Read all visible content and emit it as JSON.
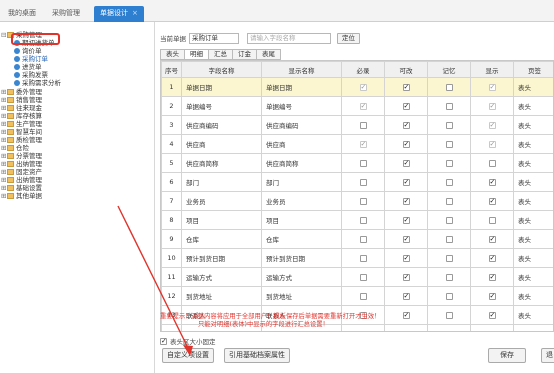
{
  "tabs": [
    {
      "label": "我的桌面"
    },
    {
      "label": "采购管理"
    },
    {
      "label": "单据设计",
      "close": "×"
    }
  ],
  "tree": [
    {
      "label": "采购管理",
      "kind": "folder",
      "toggle": "⊟"
    },
    {
      "label": "期初进货单",
      "kind": "leaf"
    },
    {
      "label": "询价单",
      "kind": "leaf"
    },
    {
      "label": "采购订单",
      "kind": "leaf",
      "selected": true
    },
    {
      "label": "进货单",
      "kind": "leaf"
    },
    {
      "label": "采购发票",
      "kind": "leaf"
    },
    {
      "label": "采购需求分析",
      "kind": "leaf"
    },
    {
      "label": "委外管理",
      "kind": "folder",
      "toggle": "⊞"
    },
    {
      "label": "销售管理",
      "kind": "folder",
      "toggle": "⊞"
    },
    {
      "label": "往来现金",
      "kind": "folder",
      "toggle": "⊞"
    },
    {
      "label": "库存核算",
      "kind": "folder",
      "toggle": "⊞"
    },
    {
      "label": "生产管理",
      "kind": "folder",
      "toggle": "⊞"
    },
    {
      "label": "智慧车间",
      "kind": "folder",
      "toggle": "⊞"
    },
    {
      "label": "质检管理",
      "kind": "folder",
      "toggle": "⊞"
    },
    {
      "label": "仓险",
      "kind": "folder",
      "toggle": "⊞"
    },
    {
      "label": "分票管理",
      "kind": "folder",
      "toggle": "⊞"
    },
    {
      "label": "出纳管理",
      "kind": "folder",
      "toggle": "⊞"
    },
    {
      "label": "固定资产",
      "kind": "folder",
      "toggle": "⊞"
    },
    {
      "label": "出纳管理",
      "kind": "folder",
      "toggle": "⊞"
    },
    {
      "label": "基础设置",
      "kind": "folder",
      "toggle": "⊞"
    },
    {
      "label": "其他单据",
      "kind": "folder",
      "toggle": "⊞"
    }
  ],
  "header": {
    "doc_label": "当前单据",
    "doc_value": "采购订单",
    "search_placeholder": "请输入字段名称",
    "locate_label": "定位"
  },
  "subtabs": [
    "表头",
    "明细",
    "汇总",
    "订金",
    "表尾"
  ],
  "table": {
    "columns": [
      "序号",
      "字段名称",
      "显示名称",
      "必录",
      "可改",
      "记忆",
      "显示",
      "页签"
    ],
    "rows": [
      {
        "no": "1",
        "field": "单据日期",
        "display": "单据日期",
        "req": [
          1,
          1
        ],
        "edit": [
          1,
          0
        ],
        "mem": [
          0,
          0
        ],
        "show": [
          1,
          1
        ],
        "tab": "表头",
        "sel": true
      },
      {
        "no": "2",
        "field": "单据编号",
        "display": "单据编号",
        "req": [
          1,
          1
        ],
        "edit": [
          1,
          0
        ],
        "mem": [
          0,
          0
        ],
        "show": [
          1,
          1
        ],
        "tab": "表头"
      },
      {
        "no": "3",
        "field": "供应商编码",
        "display": "供应商编码",
        "req": [
          0,
          0
        ],
        "edit": [
          1,
          0
        ],
        "mem": [
          0,
          0
        ],
        "show": [
          1,
          1
        ],
        "tab": "表头"
      },
      {
        "no": "4",
        "field": "供应商",
        "display": "供应商",
        "req": [
          1,
          1
        ],
        "edit": [
          1,
          0
        ],
        "mem": [
          0,
          0
        ],
        "show": [
          1,
          1
        ],
        "tab": "表头"
      },
      {
        "no": "5",
        "field": "供应商简称",
        "display": "供应商简称",
        "req": [
          0,
          0
        ],
        "edit": [
          1,
          0
        ],
        "mem": [
          0,
          0
        ],
        "show": [
          0,
          0
        ],
        "tab": "表头"
      },
      {
        "no": "6",
        "field": "部门",
        "display": "部门",
        "req": [
          0,
          0
        ],
        "edit": [
          1,
          0
        ],
        "mem": [
          0,
          0
        ],
        "show": [
          1,
          0
        ],
        "tab": "表头"
      },
      {
        "no": "7",
        "field": "业务员",
        "display": "业务员",
        "req": [
          0,
          0
        ],
        "edit": [
          1,
          0
        ],
        "mem": [
          0,
          0
        ],
        "show": [
          1,
          0
        ],
        "tab": "表头"
      },
      {
        "no": "8",
        "field": "项目",
        "display": "项目",
        "req": [
          0,
          0
        ],
        "edit": [
          1,
          0
        ],
        "mem": [
          0,
          0
        ],
        "show": [
          0,
          0
        ],
        "tab": "表头"
      },
      {
        "no": "9",
        "field": "仓库",
        "display": "仓库",
        "req": [
          0,
          0
        ],
        "edit": [
          1,
          0
        ],
        "mem": [
          0,
          0
        ],
        "show": [
          1,
          0
        ],
        "tab": "表头"
      },
      {
        "no": "10",
        "field": "预计到货日期",
        "display": "预计到货日期",
        "req": [
          0,
          0
        ],
        "edit": [
          1,
          0
        ],
        "mem": [
          0,
          0
        ],
        "show": [
          1,
          0
        ],
        "tab": "表头"
      },
      {
        "no": "11",
        "field": "运输方式",
        "display": "运输方式",
        "req": [
          0,
          0
        ],
        "edit": [
          1,
          0
        ],
        "mem": [
          0,
          0
        ],
        "show": [
          1,
          0
        ],
        "tab": "表头"
      },
      {
        "no": "12",
        "field": "到货地址",
        "display": "到货地址",
        "req": [
          0,
          0
        ],
        "edit": [
          1,
          0
        ],
        "mem": [
          0,
          0
        ],
        "show": [
          1,
          0
        ],
        "tab": "表头"
      },
      {
        "no": "13",
        "field": "联系人",
        "display": "联系人",
        "req": [
          0,
          0
        ],
        "edit": [
          1,
          0
        ],
        "mem": [
          0,
          0
        ],
        "show": [
          1,
          0
        ],
        "tab": "表头"
      },
      {
        "no": "14",
        "field": "联系电话",
        "display": "联系电话",
        "req": [
          0,
          0
        ],
        "edit": [
          1,
          0
        ],
        "mem": [
          0,
          0
        ],
        "show": [
          1,
          0
        ],
        "tab": "表头"
      },
      {
        "no": "15",
        "field": "余额单",
        "display": "余额单",
        "req": [
          0,
          0
        ],
        "edit": [
          1,
          0
        ],
        "mem": [
          0,
          0
        ],
        "show": [
          1,
          0
        ],
        "tab": "表头"
      }
    ]
  },
  "notice": {
    "line1": "重要提示：调整内容将应用于全部用户！模板保存后单据需要重新打开才生效！",
    "line2": "只能对明细(表体)中显示的字段进行汇总设置！"
  },
  "fix_size": {
    "label": "表头区大小固定",
    "checked": true
  },
  "buttons": {
    "custom": "自定义项设置",
    "reference": "引用基础档案属性",
    "save": "保存",
    "exit": "退"
  },
  "colors": {
    "accent": "#2f7fd0",
    "highlight": "#e0332c",
    "selected_row": "#fbf6d0"
  }
}
